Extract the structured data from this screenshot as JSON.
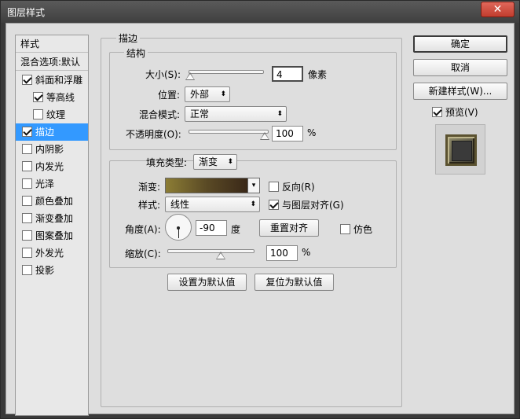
{
  "window": {
    "title": "图层样式",
    "close_glyph": "✕"
  },
  "style_list": {
    "header": "样式",
    "blend_item": "混合选项:默认",
    "items": [
      {
        "label": "斜面和浮雕",
        "checked": true
      },
      {
        "label": "等高线",
        "checked": true
      },
      {
        "label": "纹理",
        "checked": false
      },
      {
        "label": "描边",
        "checked": true
      },
      {
        "label": "内阴影",
        "checked": false
      },
      {
        "label": "内发光",
        "checked": false
      },
      {
        "label": "光泽",
        "checked": false
      },
      {
        "label": "颜色叠加",
        "checked": false
      },
      {
        "label": "渐变叠加",
        "checked": false
      },
      {
        "label": "图案叠加",
        "checked": false
      },
      {
        "label": "外发光",
        "checked": false
      },
      {
        "label": "投影",
        "checked": false
      }
    ]
  },
  "stroke": {
    "section_title": "描边",
    "structure_title": "结构",
    "size": {
      "label": "大小(S):",
      "value": "4",
      "unit": "像素",
      "level": 0.02
    },
    "position": {
      "label": "位置:",
      "value": "外部"
    },
    "blend_mode": {
      "label": "混合模式:",
      "value": "正常"
    },
    "opacity": {
      "label": "不透明度(O):",
      "value": "100",
      "unit": "%",
      "level": 1.0
    },
    "fill_type": {
      "label": "填充类型:",
      "value": "渐变"
    },
    "gradient": {
      "label": "渐变:",
      "reverse_label": "反向(R)",
      "reverse_checked": false,
      "colors": [
        "#8c7d35",
        "#5a4a25",
        "#3a2818"
      ]
    },
    "style": {
      "label": "样式:",
      "value": "线性",
      "align_label": "与图层对齐(G)",
      "align_checked": true
    },
    "angle": {
      "label": "角度(A):",
      "value": "-90",
      "unit": "度",
      "reset_button": "重置对齐",
      "dither_label": "仿色",
      "dither_checked": false
    },
    "scale": {
      "label": "缩放(C):",
      "value": "100",
      "unit": "%",
      "level": 0.5
    },
    "make_default": "设置为默认值",
    "reset_default": "复位为默认值"
  },
  "actions": {
    "ok": "确定",
    "cancel": "取消",
    "new_style": "新建样式(W)...",
    "preview_label": "预览(V)",
    "preview_checked": true
  },
  "colors": {
    "selection": "#3399ff",
    "panel": "#dedede"
  },
  "icons": {
    "dropdown": "chevron-down-icon",
    "stepper": "updown-arrows-icon",
    "check": "checkmark-icon"
  }
}
